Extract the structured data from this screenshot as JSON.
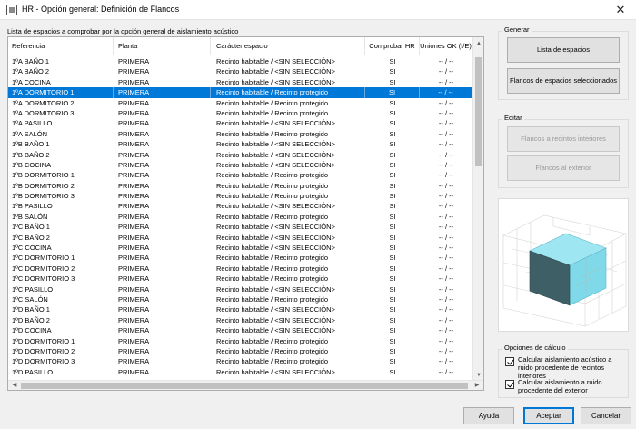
{
  "window": {
    "title": "HR - Opción general: Definición de Flancos",
    "close_glyph": "✕"
  },
  "list": {
    "label": "Lista de espacios a comprobar por la opción general de aislamiento acústico",
    "columns": [
      "Referencia",
      "Planta",
      "Carácter espacio",
      "Comprobar HR",
      "Uniones OK (I/E)"
    ],
    "selected_index": 3,
    "rows": [
      [
        "1ºA BAÑO 1",
        "PRIMERA",
        "Recinto habitable / <SIN SELECCIÓN>",
        "SI",
        "-- / --"
      ],
      [
        "1ºA BAÑO 2",
        "PRIMERA",
        "Recinto habitable / <SIN SELECCIÓN>",
        "SI",
        "-- / --"
      ],
      [
        "1ºA COCINA",
        "PRIMERA",
        "Recinto habitable / <SIN SELECCIÓN>",
        "SI",
        "-- / --"
      ],
      [
        "1ºA DORMITORIO 1",
        "PRIMERA",
        "Recinto habitable / Recinto protegido",
        "SI",
        "-- / --"
      ],
      [
        "1ºA DORMITORIO 2",
        "PRIMERA",
        "Recinto habitable / Recinto protegido",
        "SI",
        "-- / --"
      ],
      [
        "1ºA DORMITORIO 3",
        "PRIMERA",
        "Recinto habitable / Recinto protegido",
        "SI",
        "-- / --"
      ],
      [
        "1ºA PASILLO",
        "PRIMERA",
        "Recinto habitable / <SIN SELECCIÓN>",
        "SI",
        "-- / --"
      ],
      [
        "1ºA SALÓN",
        "PRIMERA",
        "Recinto habitable / Recinto protegido",
        "SI",
        "-- / --"
      ],
      [
        "1ºB BAÑO 1",
        "PRIMERA",
        "Recinto habitable / <SIN SELECCIÓN>",
        "SI",
        "-- / --"
      ],
      [
        "1ºB BAÑO 2",
        "PRIMERA",
        "Recinto habitable / <SIN SELECCIÓN>",
        "SI",
        "-- / --"
      ],
      [
        "1ºB COCINA",
        "PRIMERA",
        "Recinto habitable / <SIN SELECCIÓN>",
        "SI",
        "-- / --"
      ],
      [
        "1ºB DORMITORIO 1",
        "PRIMERA",
        "Recinto habitable / Recinto protegido",
        "SI",
        "-- / --"
      ],
      [
        "1ºB DORMITORIO 2",
        "PRIMERA",
        "Recinto habitable / Recinto protegido",
        "SI",
        "-- / --"
      ],
      [
        "1ºB DORMITORIO 3",
        "PRIMERA",
        "Recinto habitable / Recinto protegido",
        "SI",
        "-- / --"
      ],
      [
        "1ºB PASILLO",
        "PRIMERA",
        "Recinto habitable / <SIN SELECCIÓN>",
        "SI",
        "-- / --"
      ],
      [
        "1ºB SALÓN",
        "PRIMERA",
        "Recinto habitable / Recinto protegido",
        "SI",
        "-- / --"
      ],
      [
        "1ºC BAÑO 1",
        "PRIMERA",
        "Recinto habitable / <SIN SELECCIÓN>",
        "SI",
        "-- / --"
      ],
      [
        "1ºC BAÑO 2",
        "PRIMERA",
        "Recinto habitable / <SIN SELECCIÓN>",
        "SI",
        "-- / --"
      ],
      [
        "1ºC COCINA",
        "PRIMERA",
        "Recinto habitable / <SIN SELECCIÓN>",
        "SI",
        "-- / --"
      ],
      [
        "1ºC DORMITORIO 1",
        "PRIMERA",
        "Recinto habitable / Recinto protegido",
        "SI",
        "-- / --"
      ],
      [
        "1ºC DORMITORIO 2",
        "PRIMERA",
        "Recinto habitable / Recinto protegido",
        "SI",
        "-- / --"
      ],
      [
        "1ºC DORMITORIO 3",
        "PRIMERA",
        "Recinto habitable / Recinto protegido",
        "SI",
        "-- / --"
      ],
      [
        "1ºC PASILLO",
        "PRIMERA",
        "Recinto habitable / <SIN SELECCIÓN>",
        "SI",
        "-- / --"
      ],
      [
        "1ºC SALÓN",
        "PRIMERA",
        "Recinto habitable / Recinto protegido",
        "SI",
        "-- / --"
      ],
      [
        "1ºD BAÑO 1",
        "PRIMERA",
        "Recinto habitable / <SIN SELECCIÓN>",
        "SI",
        "-- / --"
      ],
      [
        "1ºD BAÑO 2",
        "PRIMERA",
        "Recinto habitable / <SIN SELECCIÓN>",
        "SI",
        "-- / --"
      ],
      [
        "1ºD COCINA",
        "PRIMERA",
        "Recinto habitable / <SIN SELECCIÓN>",
        "SI",
        "-- / --"
      ],
      [
        "1ºD DORMITORIO 1",
        "PRIMERA",
        "Recinto habitable / Recinto protegido",
        "SI",
        "-- / --"
      ],
      [
        "1ºD DORMITORIO 2",
        "PRIMERA",
        "Recinto habitable / Recinto protegido",
        "SI",
        "-- / --"
      ],
      [
        "1ºD DORMITORIO 3",
        "PRIMERA",
        "Recinto habitable / Recinto protegido",
        "SI",
        "-- / --"
      ],
      [
        "1ºD PASILLO",
        "PRIMERA",
        "Recinto habitable / <SIN SELECCIÓN>",
        "SI",
        "-- / --"
      ]
    ]
  },
  "generar": {
    "label": "Generar",
    "lista_espacios_label": "Lista de espacios",
    "flancos_seleccionados_label": "Flancos de espacios seleccionados"
  },
  "editar": {
    "label": "Editar",
    "flancos_interiores_label": "Flancos a recintos interiores",
    "flancos_exterior_label": "Flancos al exterior"
  },
  "opciones": {
    "label": "Opciones de cálculo",
    "option1_label": "Calcular aislamiento acústico a ruido procedente de recintos interiores",
    "option2_label": "Calcular aislamiento a ruido procedente del exterior"
  },
  "footer": {
    "ayuda_label": "Ayuda",
    "aceptar_label": "Aceptar",
    "cancelar_label": "Cancelar"
  },
  "colors": {
    "selection": "#0078d7",
    "box_top": "#9ee6f2",
    "box_front": "#7fd9e9",
    "box_side": "#3f5f66"
  }
}
